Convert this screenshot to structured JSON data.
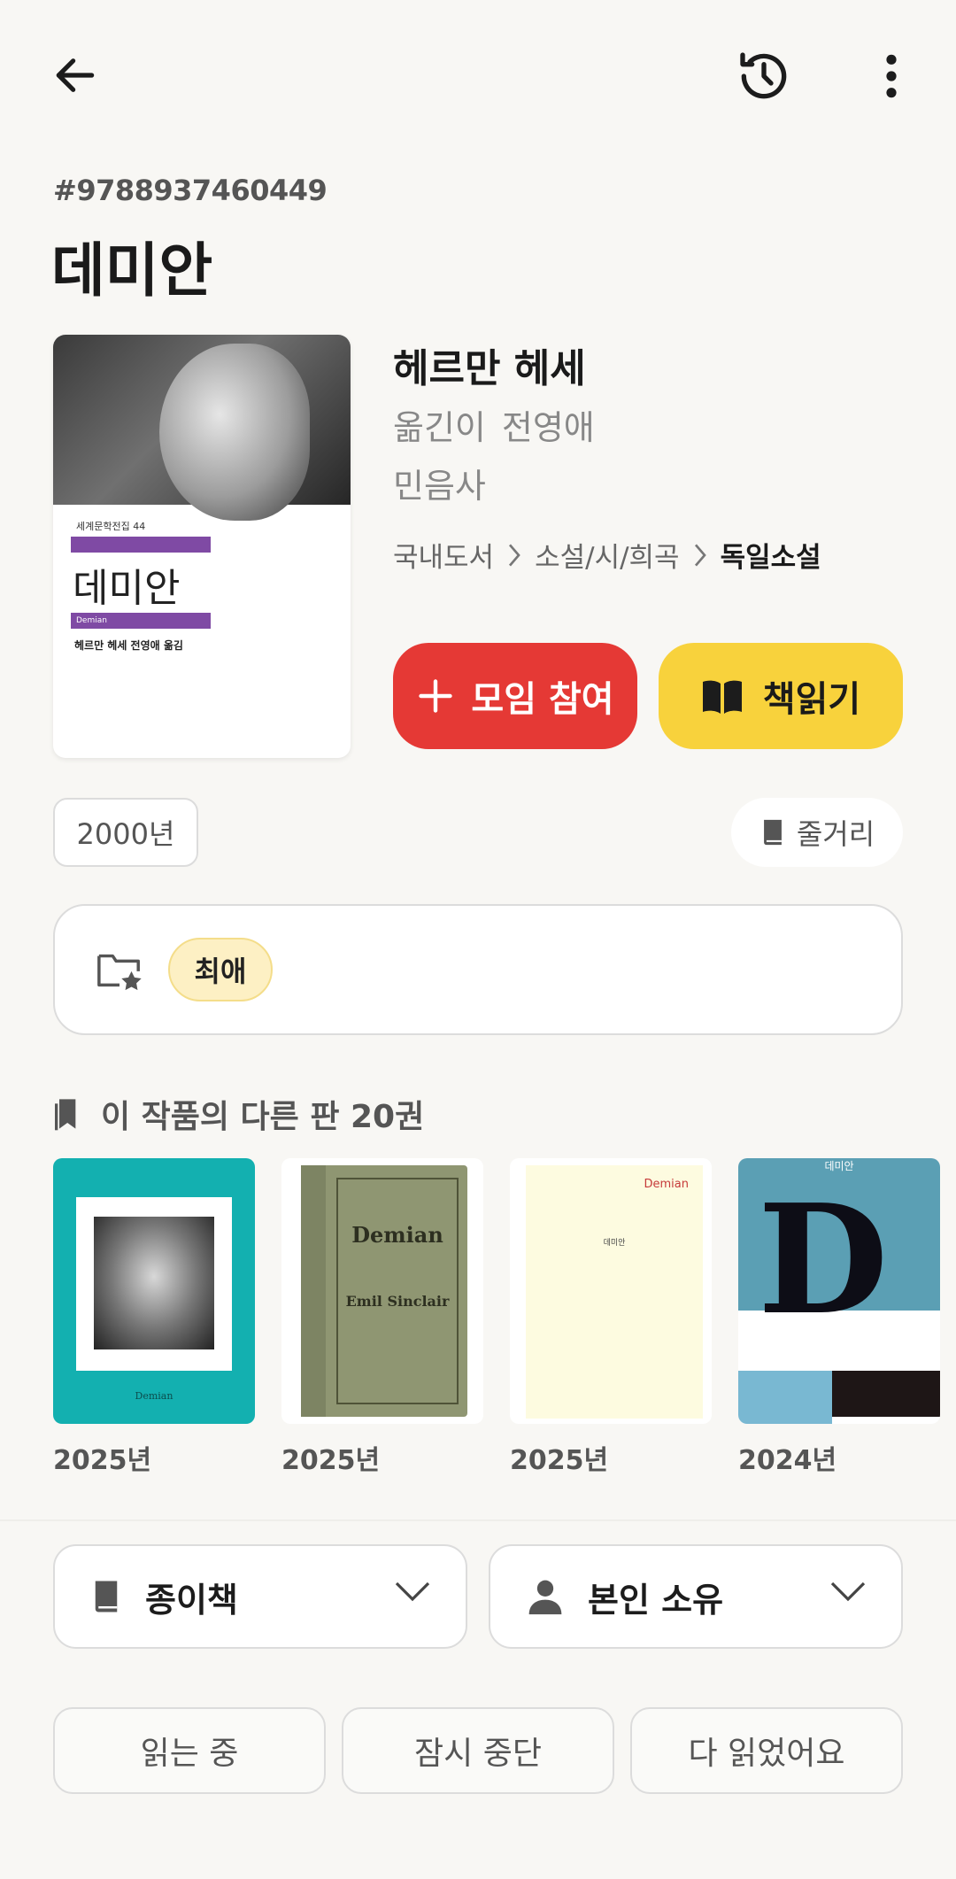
{
  "book": {
    "isbn": "#9788937460449",
    "title": "데미안",
    "author": "헤르만 헤세",
    "translator_label": "옮긴이",
    "translator_name": "전영애",
    "publisher": "민음사",
    "categories": [
      "국내도서",
      "소설/시/희곡",
      "독일소설"
    ],
    "year": "2000년"
  },
  "cover": {
    "series": "세계문학전집 44",
    "title": "데미안",
    "subtitle": "Demian",
    "author_line": "헤르만 헤세 전영애 옮김"
  },
  "actions": {
    "join_label": "모임 참여",
    "read_label": "책읽기",
    "summary_label": "줄거리"
  },
  "collection": {
    "tag": "최애"
  },
  "editions": {
    "heading": "이 작품의 다른 판 20권",
    "items": [
      {
        "year": "2025년",
        "cover_text": "Demian"
      },
      {
        "year": "2025년",
        "cover_text": "Demian",
        "cover_subtext": "Emil Sinclair"
      },
      {
        "year": "2025년",
        "cover_text": "Demian",
        "cover_subtext": "데미안"
      },
      {
        "year": "2024년",
        "cover_text": "D",
        "cover_subtext": "데미안"
      }
    ]
  },
  "selectors": {
    "format": "종이책",
    "ownership": "본인 소유"
  },
  "status": {
    "reading": "읽는 중",
    "paused": "잠시 중단",
    "finished": "다 읽었어요"
  },
  "colors": {
    "join_button": "#e53935",
    "read_button": "#f8d23c",
    "fav_chip": "#fdf0c4",
    "background": "#f8f7f4"
  }
}
